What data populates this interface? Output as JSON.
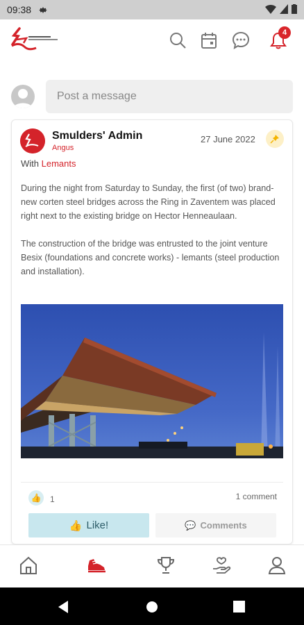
{
  "status_bar": {
    "time": "09:38"
  },
  "header": {
    "logo_alt": "Smulders Sports for Charity",
    "notification_count": "4"
  },
  "composer": {
    "placeholder": "Post a message"
  },
  "post": {
    "author": "Smulders' Admin",
    "sub_author": "Angus",
    "date": "27 June 2022",
    "with_prefix": "With",
    "with_link": "Lemants",
    "paragraphs": [
      "During the night from Saturday to Sunday, the first (of two) brand-new corten steel bridges across the Ring in Zaventem was placed right next to the existing bridge on Hector Henneaulaan.",
      "The construction of the bridge was entrusted to the joint venture Besix (foundations and concrete works) - lemants (steel production and installation)."
    ],
    "like_count": "1",
    "comment_count": "1 comment",
    "like_button": "Like!",
    "comments_button": "Comments"
  },
  "bottom_nav": [
    {
      "icon": "home-icon"
    },
    {
      "icon": "running-shoe-icon",
      "active": true
    },
    {
      "icon": "trophy-icon"
    },
    {
      "icon": "charity-hand-icon"
    },
    {
      "icon": "profile-icon"
    }
  ],
  "colors": {
    "brand_red": "#d4232a",
    "like_bg": "#c8e7ee"
  }
}
